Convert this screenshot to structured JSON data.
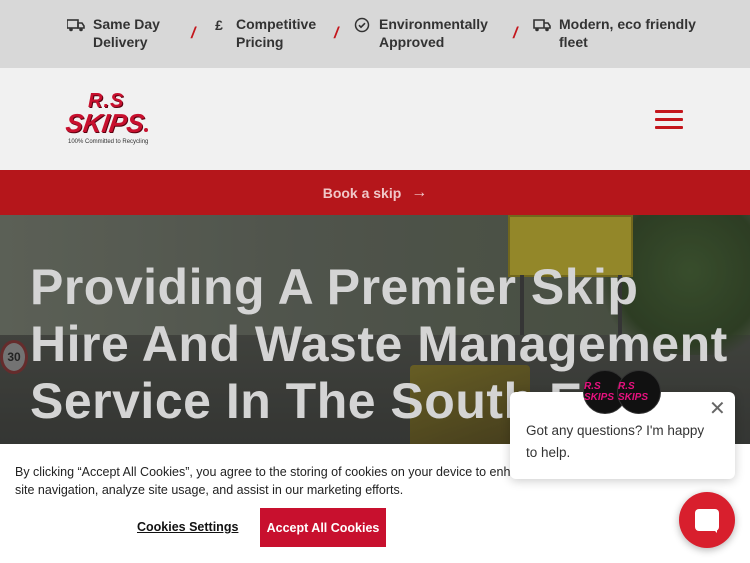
{
  "usps": [
    {
      "text": "Same Day\nDelivery",
      "icon": "delivery-truck-icon"
    },
    {
      "text": "Competitive\nPricing",
      "icon": "pound-sign-icon",
      "glyph": "£"
    },
    {
      "text": "Environmentally\nApproved",
      "icon": "check-circle-icon"
    },
    {
      "text": "Modern, eco friendly\nfleet",
      "icon": "fleet-truck-icon"
    }
  ],
  "separator": "/",
  "logo": {
    "line1": "R.S",
    "line2": "SKIPS",
    "tagline": "100% Committed to Recycling"
  },
  "book_bar": {
    "label": "Book a skip",
    "arrow": "→"
  },
  "hero": {
    "title": "Providing A Premier Skip Hire And Waste Management Service In The South E",
    "speed_sign": "30"
  },
  "cookie_banner": {
    "text": "By clicking “Accept All Cookies”, you agree to the storing of cookies on your device to enhance site navigation, analyze site usage, and assist in our marketing efforts.",
    "settings_label": "Cookies Settings",
    "accept_label": "Accept All Cookies"
  },
  "chat": {
    "message": "Got any questions? I'm happy to help.",
    "close_glyph": "✕",
    "avatar_label": "R.S SKIPS"
  },
  "colors": {
    "brand_red": "#c8102e",
    "book_bar": "#b5161b",
    "topbar": "#d8d8d8"
  }
}
